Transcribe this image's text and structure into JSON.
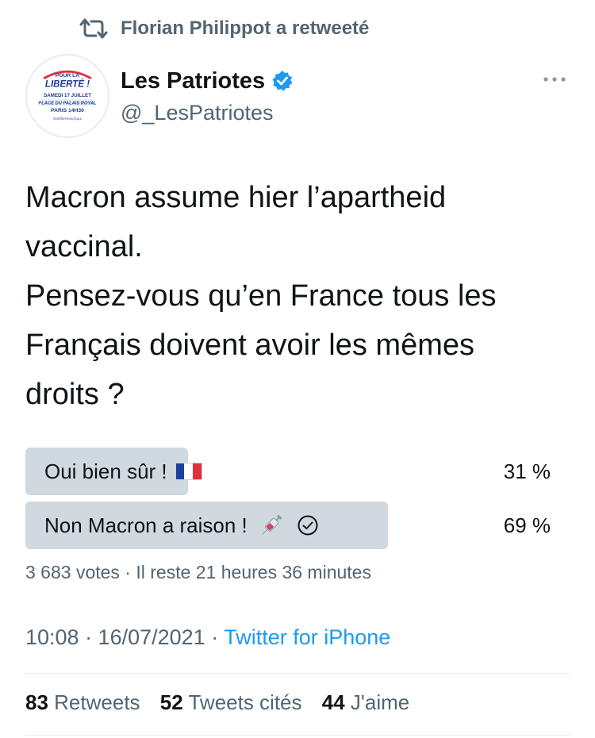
{
  "retweet": {
    "label": "Florian Philippot a retweeté",
    "icon": "retweet-icon"
  },
  "author": {
    "name": "Les Patriotes",
    "handle": "@_LesPatriotes",
    "verified": true,
    "avatar_text": [
      "POUR LA",
      "LIBERTÉ !",
      "SAMEDI 17 JUILLET",
      "PLACE DU PALAIS ROYAL",
      "PARIS 14H30",
      "#DéfiléHistorique"
    ]
  },
  "tweet": {
    "lines": [
      "Macron assume hier l’apartheid",
      "vaccinal.",
      "Pensez-vous qu’en France tous les",
      "Français doivent avoir les mêmes",
      "droits ?"
    ]
  },
  "poll": {
    "options": [
      {
        "label": "Oui bien sûr !",
        "percent_text": "31 %",
        "percent": 31,
        "emoji": "flag-france-icon",
        "selected": false
      },
      {
        "label": "Non Macron a raison !",
        "percent_text": "69 %",
        "percent": 69,
        "emoji": "syringe-icon",
        "selected": true
      }
    ],
    "meta": "3 683 votes · Il reste 21 heures 36 minutes"
  },
  "timestamp": {
    "time_date": "10:08 · 16/07/2021 · ",
    "source": "Twitter for iPhone"
  },
  "stats": {
    "retweets_count": "83",
    "retweets_label": "Retweets",
    "quotes_count": "52",
    "quotes_label": "Tweets cités",
    "likes_count": "44",
    "likes_label": "J'aime"
  },
  "colors": {
    "text": "#0f1419",
    "secondary": "#536471",
    "link": "#1d9bf0",
    "poll_fill": "#cfd9de",
    "divider": "#e6ecf0"
  }
}
